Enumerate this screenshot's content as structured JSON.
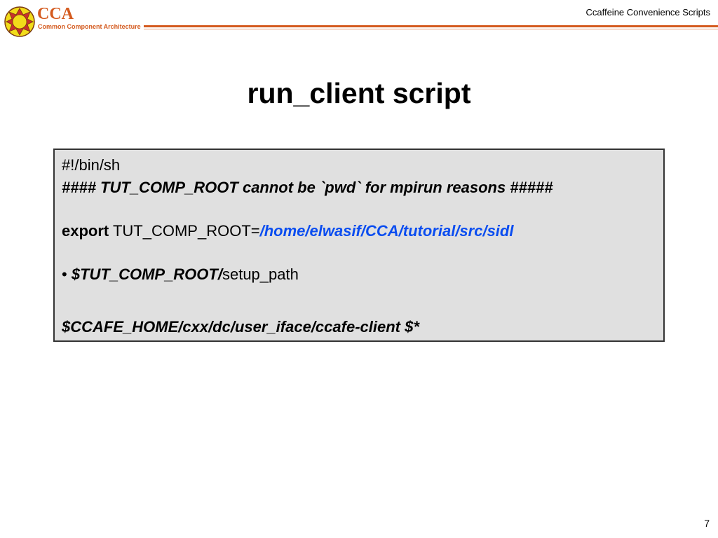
{
  "header": {
    "logo_text": "CCA",
    "logo_subtitle": "Common Component Architecture",
    "title": "Ccaffeine Convenience Scripts"
  },
  "slide": {
    "title": "run_client script",
    "page_number": "7"
  },
  "code": {
    "line1": "#!/bin/sh",
    "line2": "#### TUT_COMP_ROOT cannot be `pwd` for mpirun reasons #####",
    "line3_keyword": "export",
    "line3_var": " TUT_COMP_ROOT=",
    "line3_value": "/home/elwasif/CCA/tutorial/src/sidl",
    "line4_bullet": "• ",
    "line4_var": "$TUT_COMP_ROOT/",
    "line4_rest": "setup_path",
    "line5": "$CCAFE_HOME/cxx/dc/user_iface/ccafe-client $*"
  },
  "colors": {
    "brand": "#d45a1e",
    "link": "#0a4df0",
    "box": "#e0e0e0"
  }
}
